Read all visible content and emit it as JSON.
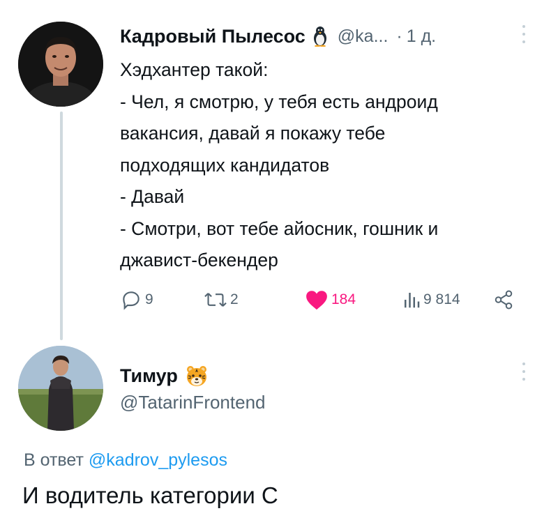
{
  "tweet": {
    "author_name": "Кадровый Пылесос",
    "author_handle": "@ka...",
    "separator": "·",
    "time": "1 д.",
    "lines": [
      "Хэдхантер такой:",
      "- Чел, я смотрю, у тебя есть андроид",
      "вакансия, давай я покажу тебе",
      "подходящих кандидатов",
      "- Давай",
      "- Смотри, вот тебе айосник, гошник и",
      "джавист-бекендер"
    ],
    "stats": {
      "replies": "9",
      "retweets": "2",
      "likes": "184",
      "views": "9 814"
    },
    "colors": {
      "like": "#f91880",
      "muted": "#536471",
      "link": "#1d9bf0"
    }
  },
  "reply": {
    "author_name": "Тимур",
    "author_handle": "@TatarinFrontend",
    "reply_prefix": "В ответ",
    "reply_to": "@kadrov_pylesos",
    "text": "И водитель категории С"
  },
  "icons": [
    "penguin-emoji-icon",
    "more-icon",
    "reply-icon",
    "retweet-icon",
    "heart-icon",
    "views-icon",
    "share-icon",
    "tiger-emoji-icon"
  ]
}
